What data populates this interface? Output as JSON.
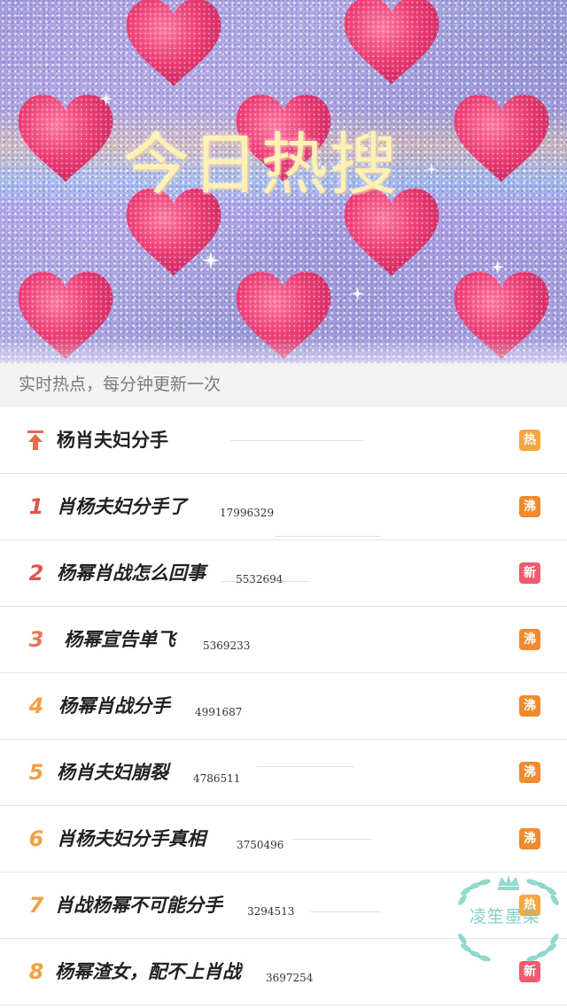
{
  "banner": {
    "title": "今日热搜"
  },
  "subtitle": "实时热点，每分钟更新一次",
  "rows": [
    {
      "rank": "",
      "topic": "杨肖夫妇分手",
      "count": "",
      "badge": "热",
      "badge_type": "hot",
      "pinned": true
    },
    {
      "rank": "1",
      "topic": "肖杨夫妇分手了",
      "count": "17996329",
      "badge": "沸",
      "badge_type": "boil"
    },
    {
      "rank": "2",
      "topic": "杨幂肖战怎么回事",
      "count": "5532694",
      "badge": "新",
      "badge_type": "new"
    },
    {
      "rank": "3",
      "topic": "杨幂宣告单飞",
      "count": "5369233",
      "badge": "沸",
      "badge_type": "boil"
    },
    {
      "rank": "4",
      "topic": "杨幂肖战分手",
      "count": "4991687",
      "badge": "沸",
      "badge_type": "boil"
    },
    {
      "rank": "5",
      "topic": "杨肖夫妇崩裂",
      "count": "4786511",
      "badge": "沸",
      "badge_type": "boil"
    },
    {
      "rank": "6",
      "topic": "肖杨夫妇分手真相",
      "count": "3750496",
      "badge": "沸",
      "badge_type": "boil"
    },
    {
      "rank": "7",
      "topic": "肖战杨幂不可能分手",
      "count": "3294513",
      "badge": "热",
      "badge_type": "hot"
    },
    {
      "rank": "8",
      "topic": "杨幂渣女，配不上肖战",
      "count": "3697254",
      "badge": "新",
      "badge_type": "new"
    }
  ],
  "watermark": {
    "text": "凌笙墨染"
  },
  "icons": {
    "pin": "pin-to-top-icon",
    "watermark_laurel": "laurel-icon",
    "watermark_crown": "crown-icon",
    "banner_hearts": "heart-icon"
  },
  "colors": {
    "badge_hot": "#f6a63a",
    "badge_boil": "#f08a2e",
    "badge_new": "#f05a6c",
    "rank_red": "#e0534e",
    "rank_orange": "#f0a045",
    "title_yellow": "#fff1b3"
  }
}
